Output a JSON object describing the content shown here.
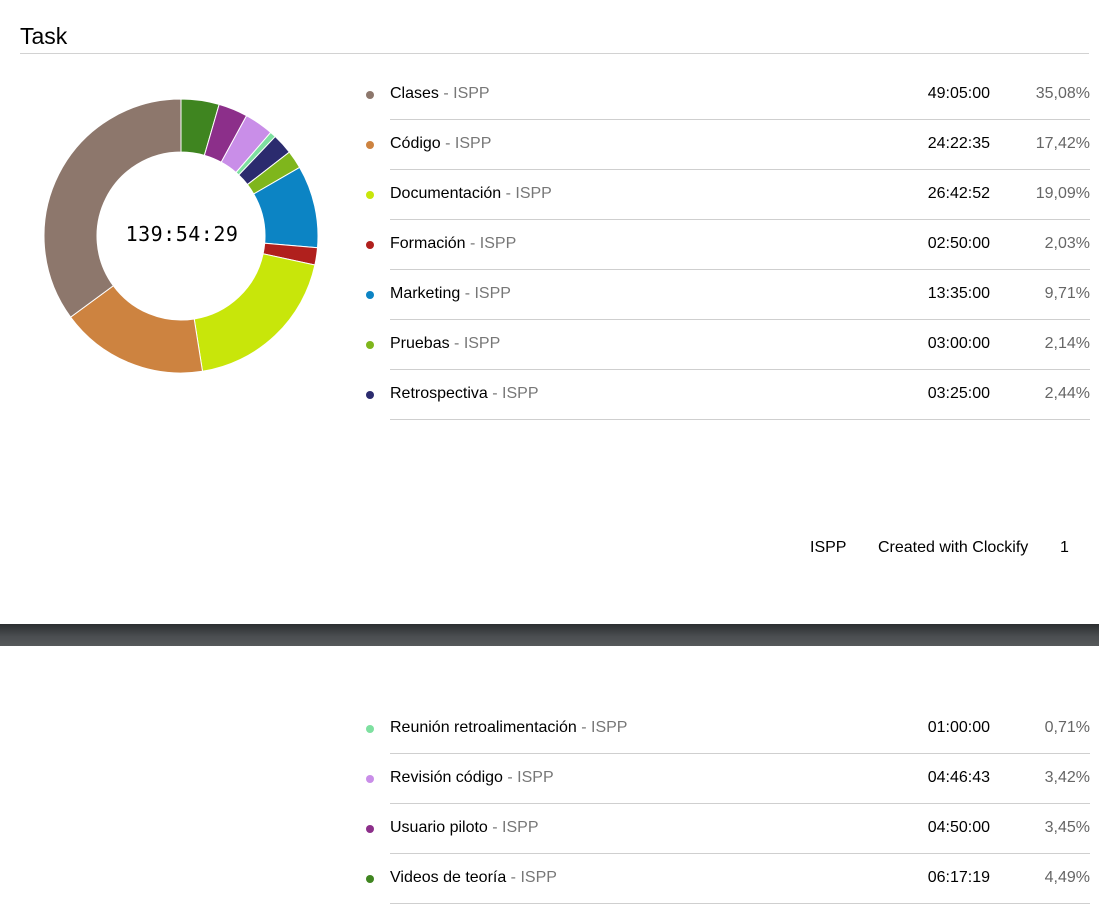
{
  "header": {
    "title": "Task"
  },
  "total_duration": "139:54:29",
  "tasks": [
    {
      "name": "Clases",
      "project": "ISPP",
      "duration": "49:05:00",
      "percent": "35,08%",
      "color": "#8d776c"
    },
    {
      "name": "Código",
      "project": "ISPP",
      "duration": "24:22:35",
      "percent": "17,42%",
      "color": "#cd8340"
    },
    {
      "name": "Documentación",
      "project": "ISPP",
      "duration": "26:42:52",
      "percent": "19,09%",
      "color": "#c8e60a"
    },
    {
      "name": "Formación",
      "project": "ISPP",
      "duration": "02:50:00",
      "percent": "2,03%",
      "color": "#b0201d"
    },
    {
      "name": "Marketing",
      "project": "ISPP",
      "duration": "13:35:00",
      "percent": "9,71%",
      "color": "#0c84c4"
    },
    {
      "name": "Pruebas",
      "project": "ISPP",
      "duration": "03:00:00",
      "percent": "2,14%",
      "color": "#7fb61c"
    },
    {
      "name": "Retrospectiva",
      "project": "ISPP",
      "duration": "03:25:00",
      "percent": "2,44%",
      "color": "#2b2b6e"
    },
    {
      "name": "Reunión retroalimentación",
      "project": "ISPP",
      "duration": "01:00:00",
      "percent": "0,71%",
      "color": "#7ee0a0"
    },
    {
      "name": "Revisión código",
      "project": "ISPP",
      "duration": "04:46:43",
      "percent": "3,42%",
      "color": "#c98ee8"
    },
    {
      "name": "Usuario piloto",
      "project": "ISPP",
      "duration": "04:50:00",
      "percent": "3,45%",
      "color": "#8c2f8a"
    },
    {
      "name": "Videos de teoría",
      "project": "ISPP",
      "duration": "06:17:19",
      "percent": "4,49%",
      "color": "#3f8520"
    }
  ],
  "footer": {
    "project": "ISPP",
    "created_with": "Created with Clockify",
    "page_number": "1"
  },
  "chart_data": {
    "type": "pie",
    "donut": true,
    "center_label": "139:54:29",
    "clockwise_from_top_order": [
      "Videos de teoría",
      "Usuario piloto",
      "Revisión código",
      "Reunión retroalimentación",
      "Retrospectiva",
      "Pruebas",
      "Marketing",
      "Formación",
      "Documentación",
      "Código",
      "Clases"
    ]
  }
}
